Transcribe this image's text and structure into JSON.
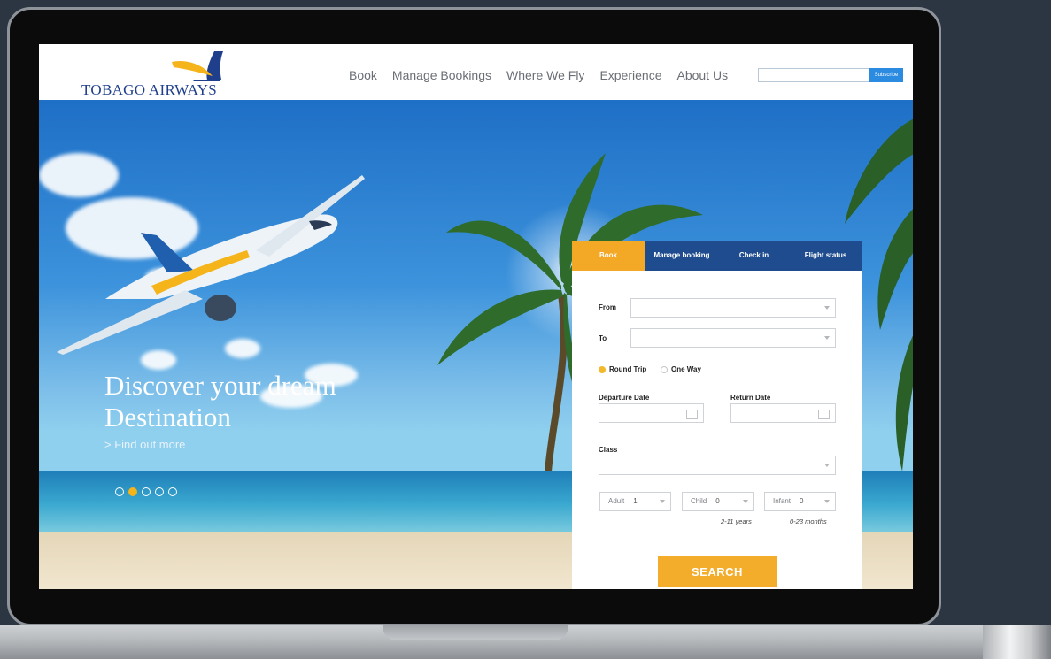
{
  "brand": {
    "name": "TOBAGO AIRWAYS"
  },
  "nav": {
    "items": [
      {
        "label": "Book"
      },
      {
        "label": "Manage Bookings"
      },
      {
        "label": "Where We Fly"
      },
      {
        "label": "Experience"
      },
      {
        "label": "About Us"
      }
    ]
  },
  "subscribe": {
    "placeholder": "",
    "button_label": "Subscribe"
  },
  "hero": {
    "title_line1": "Discover your dream",
    "title_line2": "Destination",
    "link": "> Find out more",
    "slider": {
      "count": 5,
      "active_index": 1
    }
  },
  "booking": {
    "tabs": [
      {
        "label": "Book",
        "active": true
      },
      {
        "label": "Manage booking",
        "active": false
      },
      {
        "label": "Check in",
        "active": false
      },
      {
        "label": "Flight status",
        "active": false
      }
    ],
    "from_label": "From",
    "to_label": "To",
    "trip_type": {
      "round_trip": "Round Trip",
      "one_way": "One Way",
      "selected": "Round Trip"
    },
    "departure_label": "Departure Date",
    "return_label": "Return Date",
    "class_label": "Class",
    "passengers": {
      "adult": {
        "label": "Adult",
        "value": "1"
      },
      "child": {
        "label": "Child",
        "value": "0",
        "hint": "2-11 years"
      },
      "infant": {
        "label": "Infant",
        "value": "0",
        "hint": "0-23 months"
      }
    },
    "search_label": "SEARCH"
  },
  "colors": {
    "accent": "#f3a826",
    "nav_blue": "#1e4c8f",
    "brand_blue": "#1f3f8c"
  }
}
